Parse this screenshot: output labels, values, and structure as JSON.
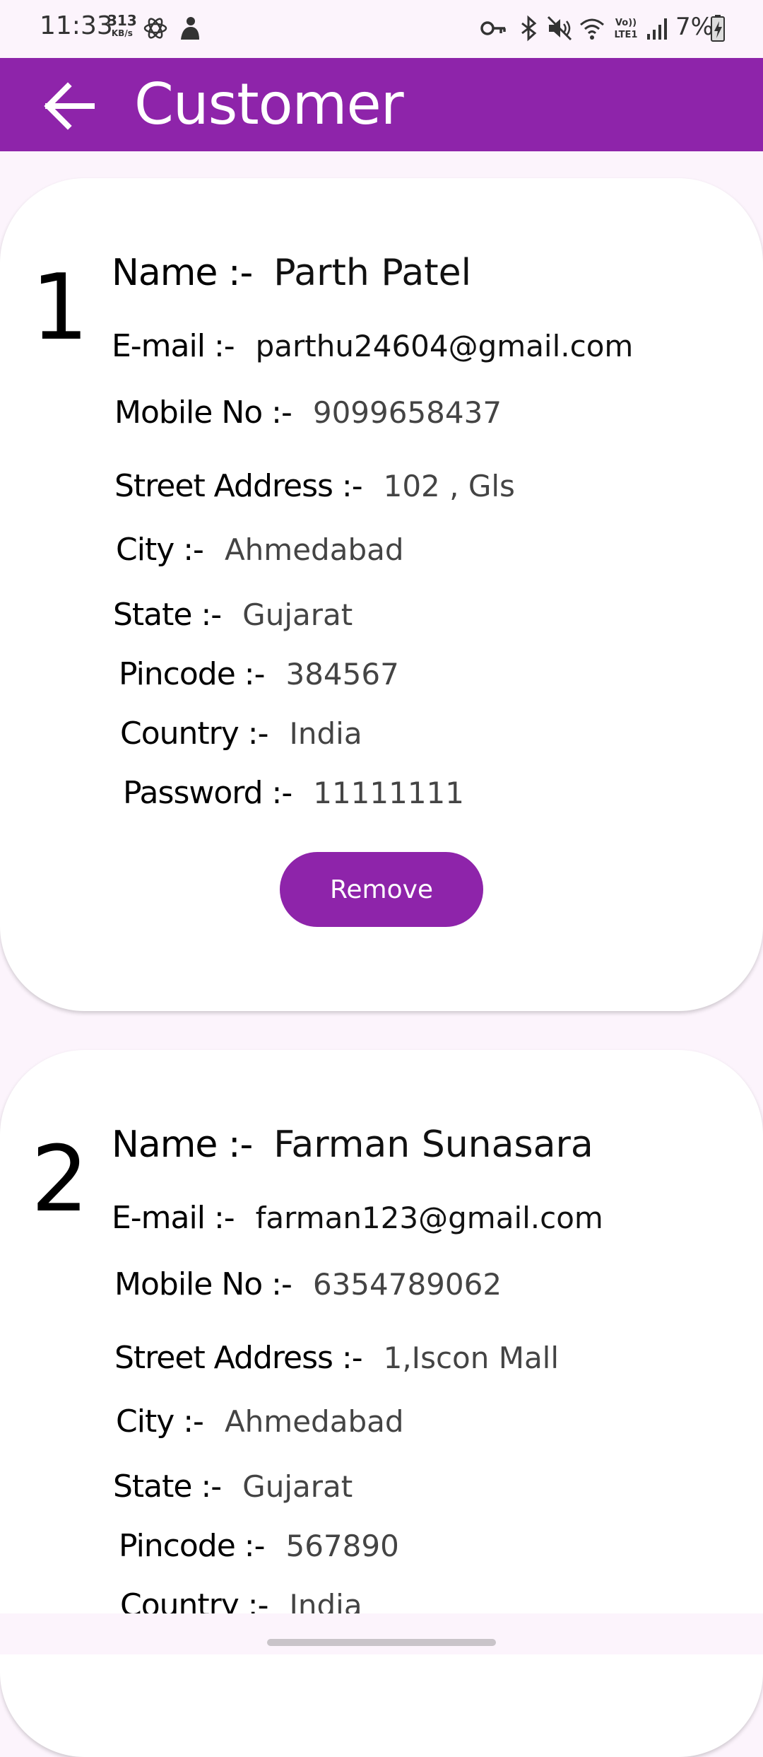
{
  "status_bar": {
    "time": "11:33",
    "net_speed": "313",
    "net_unit": "KB/s",
    "battery": "7%"
  },
  "app_bar": {
    "title": "Customer",
    "back_icon": "arrow-left-icon"
  },
  "labels": {
    "name": "Name :-",
    "email": "E-mail :-",
    "mobile": "Mobile No :-",
    "street": "Street Address :-",
    "city": "City :-",
    "state": "State :-",
    "pincode": "Pincode :-",
    "country": "Country :-",
    "password": "Password :-",
    "remove": "Remove"
  },
  "customers": [
    {
      "index": "1",
      "name": "Parth Patel",
      "email": "parthu24604@gmail.com",
      "mobile": "9099658437",
      "street": "102 , Gls",
      "city": "Ahmedabad",
      "state": "Gujarat",
      "pincode": "384567",
      "country": "India",
      "password": "11111111"
    },
    {
      "index": "2",
      "name": "Farman Sunasara",
      "email": "farman123@gmail.com",
      "mobile": "6354789062",
      "street": "1,Iscon Mall",
      "city": "Ahmedabad",
      "state": "Gujarat",
      "pincode": "567890",
      "country": "India"
    }
  ],
  "colors": {
    "primary": "#8e24aa",
    "background": "#fcf4fc",
    "card": "#ffffff"
  }
}
